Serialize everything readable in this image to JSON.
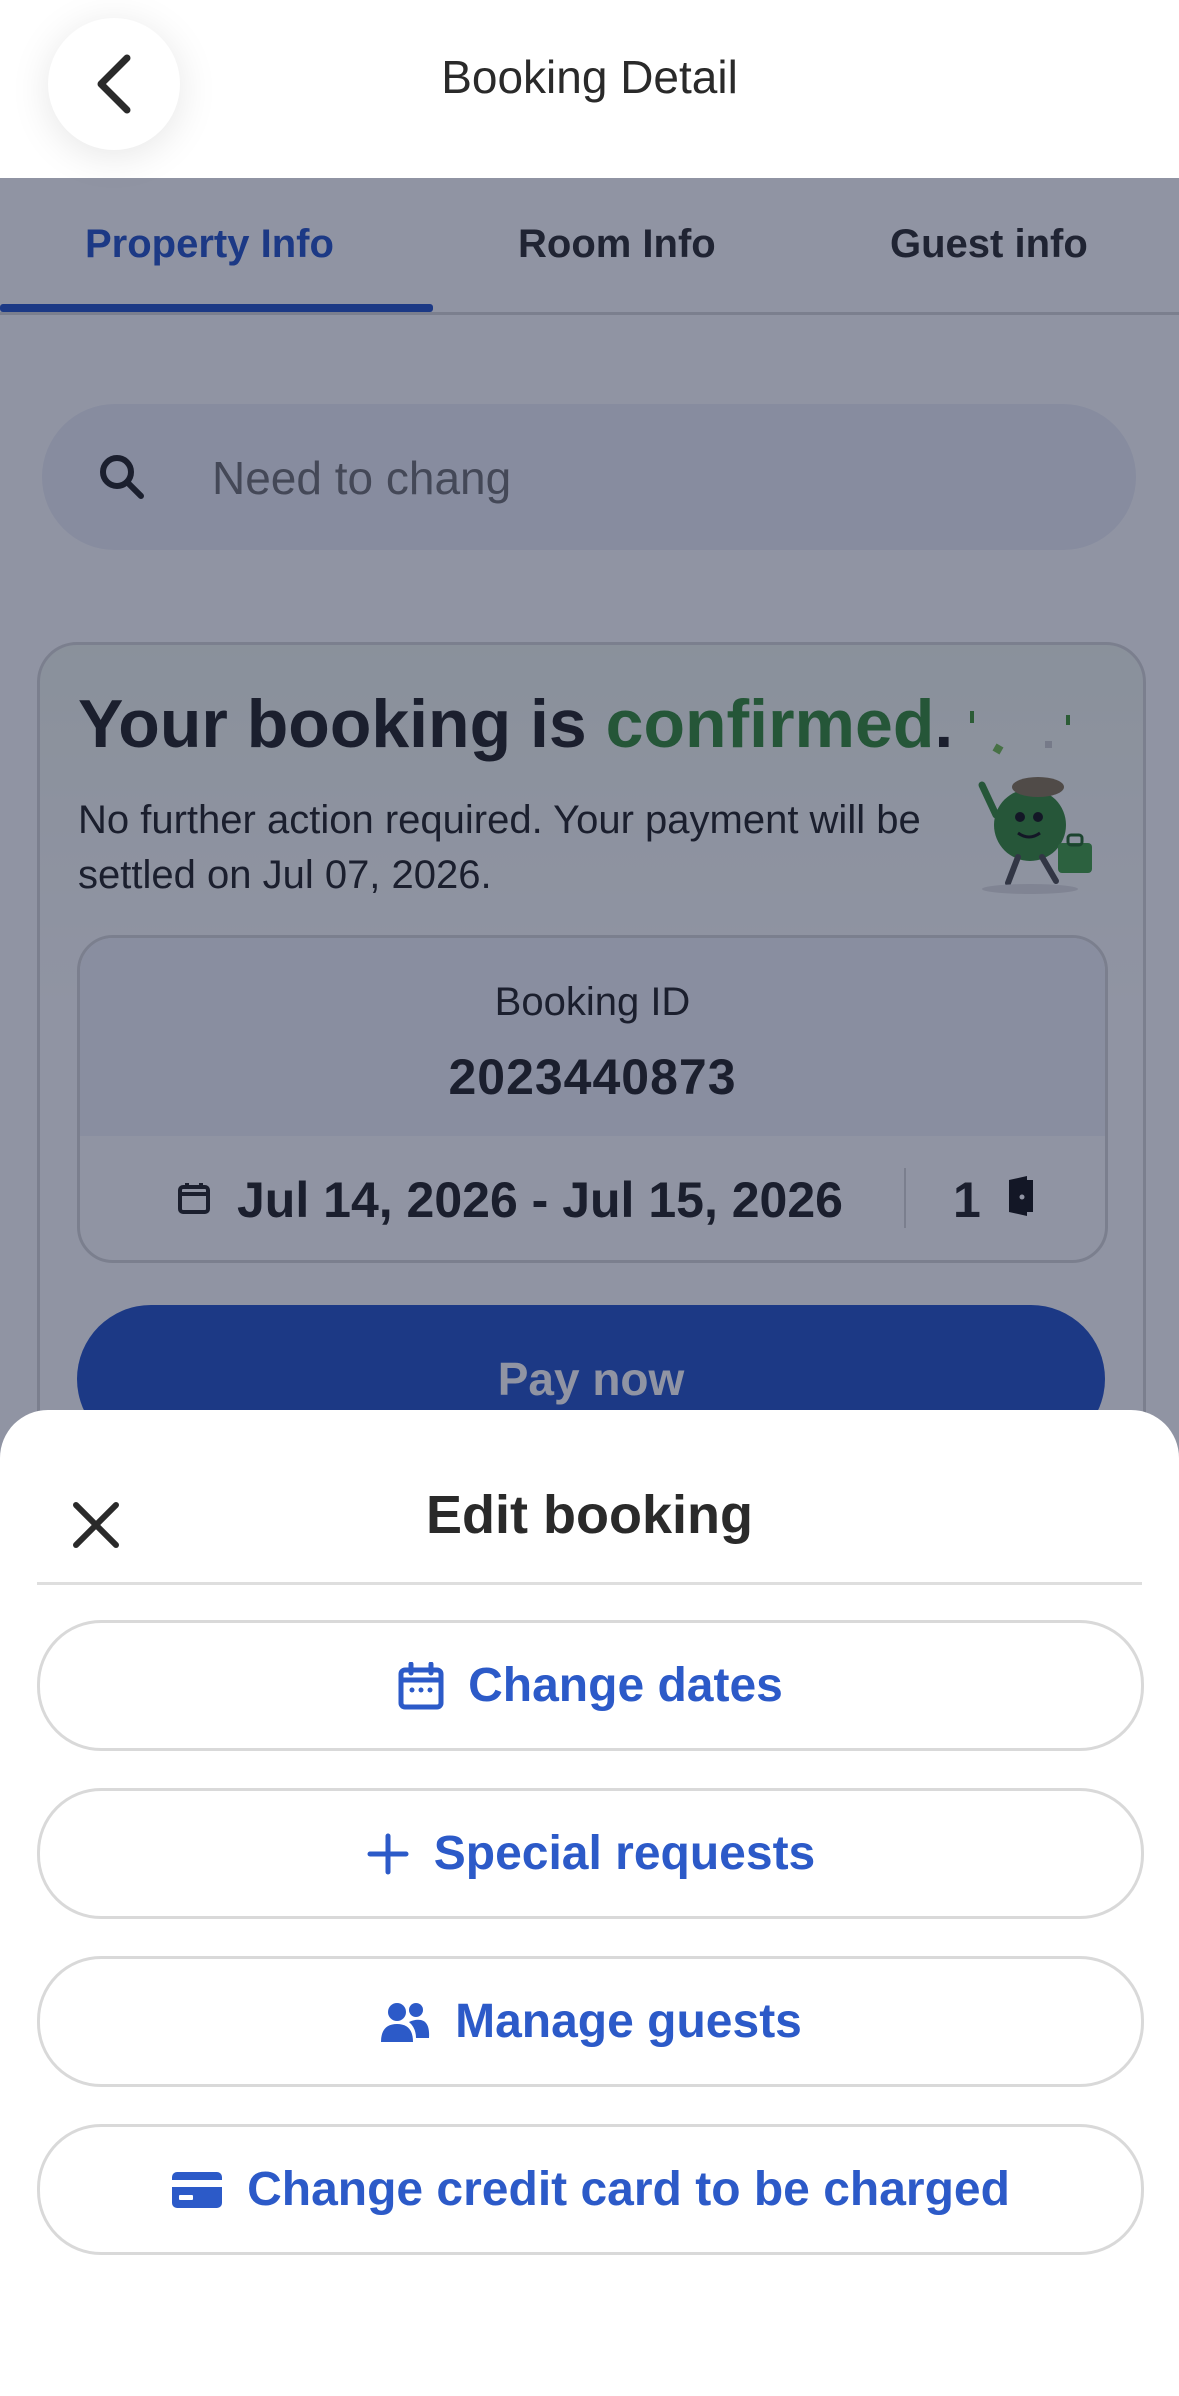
{
  "header": {
    "title": "Booking Detail"
  },
  "tabs": [
    {
      "label": "Property Info",
      "active": true
    },
    {
      "label": "Room Info",
      "active": false
    },
    {
      "label": "Guest info",
      "active": false
    }
  ],
  "search": {
    "value": "",
    "placeholder": "Need to chang"
  },
  "confirmation": {
    "title_prefix": "Your booking is ",
    "title_status": "confirmed",
    "title_suffix": ".",
    "description": "No further action required. Your payment will be settled on Jul 07, 2026."
  },
  "booking": {
    "id_label": "Booking ID",
    "id_value": "2023440873",
    "dates": "Jul 14, 2026 - Jul 15, 2026",
    "rooms": "1"
  },
  "pay_button": {
    "label": "Pay now"
  },
  "sheet": {
    "title": "Edit booking",
    "actions": [
      {
        "label": "Change dates",
        "icon": "calendar-icon"
      },
      {
        "label": "Special requests",
        "icon": "plus-icon"
      },
      {
        "label": "Manage guests",
        "icon": "users-icon"
      },
      {
        "label": "Change credit card to be charged",
        "icon": "credit-card-icon"
      }
    ]
  },
  "colors": {
    "accent": "#2c5ac8",
    "confirmed": "#3c8f3c",
    "overlay": "rgba(8,18,50,0.45)"
  }
}
